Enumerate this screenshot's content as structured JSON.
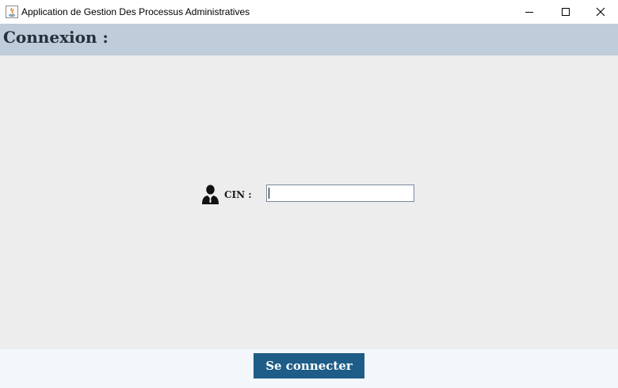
{
  "window": {
    "title": "Application de Gestion Des Processus Administratives",
    "app_icon": "java-icon",
    "controls": {
      "minimize_icon": "minimize-icon",
      "maximize_icon": "maximize-icon",
      "close_icon": "close-icon"
    }
  },
  "header": {
    "title": "Connexion :"
  },
  "form": {
    "cin_icon": "user-icon",
    "cin_label": "CIN :",
    "cin_value": ""
  },
  "footer": {
    "connect_label": "Se connecter"
  },
  "colors": {
    "header_band": "#bfccd9",
    "main_background": "#ededed",
    "footer_background": "#f3f6fa",
    "button_background": "#1d5d88",
    "button_text": "#ffffff"
  }
}
